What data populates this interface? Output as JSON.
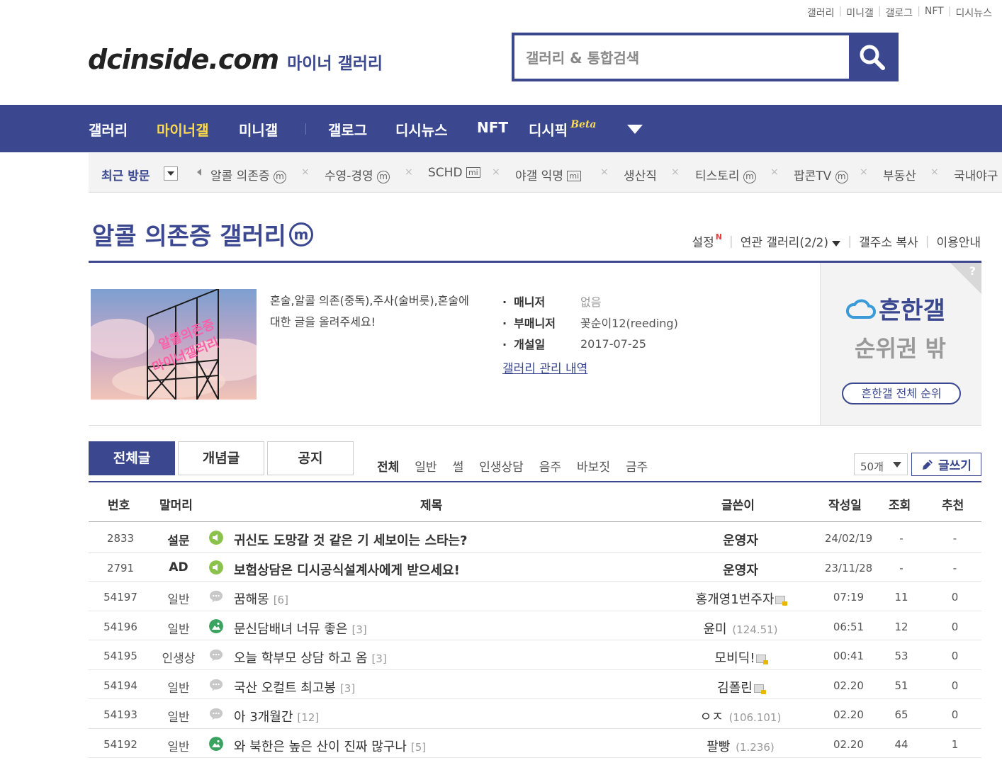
{
  "top_links": [
    "갤러리",
    "미니갤",
    "갤로그",
    "NFT",
    "디시뉴스"
  ],
  "logo": {
    "brand": "dcinside.com",
    "sub": "마이너 갤러리"
  },
  "search": {
    "placeholder": "갤러리 & 통합검색"
  },
  "nav": {
    "items": [
      "갤러리",
      "마이너갤",
      "미니갤",
      "갤로그",
      "디시뉴스",
      "NFT",
      "디시픽"
    ],
    "beta": "Beta",
    "active": "마이너갤"
  },
  "recent": {
    "label": "최근 방문",
    "items": [
      "알콜 의존증",
      "수영-경영",
      "SCHD",
      "야갤 익명",
      "생산직",
      "티스토리",
      "팝콘TV",
      "부동산",
      "국내야구"
    ],
    "badge_m": "m",
    "badge_mi": "mi"
  },
  "gallery": {
    "title": "알콜 의존증 갤러리",
    "badge": "m",
    "menu": [
      "설정",
      "연관 갤러리(2/2)",
      "갤주소 복사",
      "이용안내"
    ],
    "new_mark": "N",
    "thumb_text_1": "알콜의존증",
    "thumb_text_2": "마이너갤러리",
    "description": "혼술,알콜 의존(중독),주사(술버릇),혼술에 대한 글을 올려주세요!",
    "manager_label": "매니저",
    "manager": "없음",
    "submanager_label": "부매니저",
    "submanager": "꽃순이12(reeding)",
    "opened_label": "개설일",
    "opened": "2017-07-25",
    "history_link": "갤러리 관리 내역"
  },
  "rank": {
    "name": "흔한갤",
    "state": "순위권 밖",
    "button": "흔한갤 전체 순위",
    "help": "?"
  },
  "tabs": [
    "전체글",
    "개념글",
    "공지"
  ],
  "heads": [
    "전체",
    "일반",
    "썰",
    "인생상담",
    "음주",
    "바보짓",
    "금주"
  ],
  "list_count": "50개",
  "write_button": "글쓰기",
  "table_headers": [
    "번호",
    "말머리",
    "제목",
    "글쓴이",
    "작성일",
    "조회",
    "추천"
  ],
  "rows": [
    {
      "num": "2833",
      "head": "설문",
      "title": "귀신도 도망갈 것 같은 기 세보이는 스타는?",
      "reply": "",
      "writer": "운영자",
      "ip": "",
      "date": "24/02/19",
      "view": "-",
      "rec": "-",
      "type": "notice"
    },
    {
      "num": "2791",
      "head": "AD",
      "title": "보험상담은 디시공식설계사에게 받으세요!",
      "reply": "",
      "writer": "운영자",
      "ip": "",
      "date": "23/11/28",
      "view": "-",
      "rec": "-",
      "type": "notice"
    },
    {
      "num": "54197",
      "head": "일반",
      "title": "꿈해몽",
      "reply": "[6]",
      "writer": "홍개영1번주자",
      "ip": "",
      "date": "07:19",
      "view": "11",
      "rec": "0",
      "type": "text",
      "fixed": true
    },
    {
      "num": "54196",
      "head": "일반",
      "title": "문신담배녀 너뮤 좋은",
      "reply": "[3]",
      "writer": "윤미",
      "ip": "(124.51)",
      "date": "06:51",
      "view": "12",
      "rec": "0",
      "type": "image"
    },
    {
      "num": "54195",
      "head": "인생상",
      "title": "오늘 학부모 상담 하고 옴",
      "reply": "[3]",
      "writer": "모비딕!",
      "ip": "",
      "date": "00:41",
      "view": "53",
      "rec": "0",
      "type": "text",
      "fixed": true
    },
    {
      "num": "54194",
      "head": "일반",
      "title": "국산 오컬트 최고봉",
      "reply": "[3]",
      "writer": "김폴린",
      "ip": "",
      "date": "02.20",
      "view": "51",
      "rec": "0",
      "type": "text",
      "fixed": true
    },
    {
      "num": "54193",
      "head": "일반",
      "title": "아 3개월간",
      "reply": "[12]",
      "writer": "ㅇㅈ",
      "ip": "(106.101)",
      "date": "02.20",
      "view": "65",
      "rec": "0",
      "type": "text"
    },
    {
      "num": "54192",
      "head": "일반",
      "title": "와 북한은 높은 산이 진짜 많구나",
      "reply": "[5]",
      "writer": "팔빵",
      "ip": "(1.236)",
      "date": "02.20",
      "view": "44",
      "rec": "1",
      "type": "image"
    }
  ],
  "colors": {
    "brand": "#3b4890",
    "active_nav": "#fcd94c",
    "notice_icon": "#8bc34a",
    "image_icon": "#3aa35f"
  }
}
